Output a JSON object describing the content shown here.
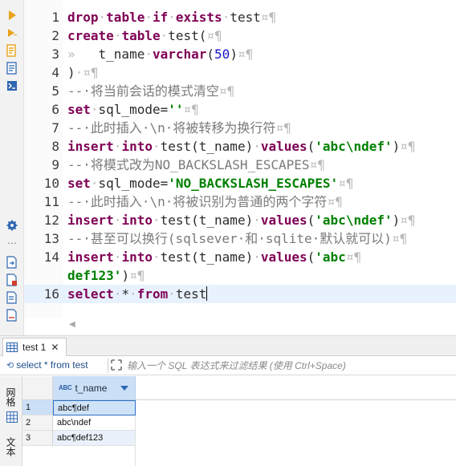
{
  "editor": {
    "lines": [
      {
        "num": "1",
        "tokens": [
          {
            "t": "drop",
            "c": "kw"
          },
          {
            "t": "·",
            "c": "ws"
          },
          {
            "t": "table",
            "c": "kw"
          },
          {
            "t": "·",
            "c": "ws"
          },
          {
            "t": "if",
            "c": "kw"
          },
          {
            "t": "·",
            "c": "ws"
          },
          {
            "t": "exists",
            "c": "kw"
          },
          {
            "t": "·",
            "c": "ws"
          },
          {
            "t": "test",
            "c": "id"
          },
          {
            "t": "¤¶",
            "c": "ws"
          }
        ]
      },
      {
        "num": "2",
        "tokens": [
          {
            "t": "create",
            "c": "kw"
          },
          {
            "t": "·",
            "c": "ws"
          },
          {
            "t": "table",
            "c": "kw"
          },
          {
            "t": "·",
            "c": "ws"
          },
          {
            "t": "test(",
            "c": "id"
          },
          {
            "t": "¤¶",
            "c": "ws"
          }
        ]
      },
      {
        "num": "3",
        "tokens": [
          {
            "t": "»   ",
            "c": "ws"
          },
          {
            "t": "t_name",
            "c": "id"
          },
          {
            "t": "·",
            "c": "ws"
          },
          {
            "t": "varchar",
            "c": "kw"
          },
          {
            "t": "(",
            "c": "id"
          },
          {
            "t": "50",
            "c": "num"
          },
          {
            "t": ")",
            "c": "id"
          },
          {
            "t": "¤¶",
            "c": "ws"
          }
        ]
      },
      {
        "num": "4",
        "tokens": [
          {
            "t": ")",
            "c": "id"
          },
          {
            "t": "·¤¶",
            "c": "ws"
          }
        ]
      },
      {
        "num": "5",
        "tokens": [
          {
            "t": "--·将当前会话的模式清空",
            "c": "cm"
          },
          {
            "t": "¤¶",
            "c": "ws"
          }
        ]
      },
      {
        "num": "6",
        "tokens": [
          {
            "t": "set",
            "c": "kw"
          },
          {
            "t": "·",
            "c": "ws"
          },
          {
            "t": "sql_mode=",
            "c": "id"
          },
          {
            "t": "''",
            "c": "str"
          },
          {
            "t": "¤¶",
            "c": "ws"
          }
        ]
      },
      {
        "num": "7",
        "tokens": [
          {
            "t": "--·此时插入·\\n·将被转移为换行符",
            "c": "cm"
          },
          {
            "t": "¤¶",
            "c": "ws"
          }
        ]
      },
      {
        "num": "8",
        "tokens": [
          {
            "t": "insert",
            "c": "kw"
          },
          {
            "t": "·",
            "c": "ws"
          },
          {
            "t": "into",
            "c": "kw"
          },
          {
            "t": "·",
            "c": "ws"
          },
          {
            "t": "test(t_name)",
            "c": "id"
          },
          {
            "t": "·",
            "c": "ws"
          },
          {
            "t": "values",
            "c": "kw"
          },
          {
            "t": "(",
            "c": "id"
          },
          {
            "t": "'abc\\ndef'",
            "c": "str"
          },
          {
            "t": ")",
            "c": "id"
          },
          {
            "t": "¤¶",
            "c": "ws"
          }
        ]
      },
      {
        "num": "9",
        "tokens": [
          {
            "t": "--·将模式改为NO_BACKSLASH_ESCAPES",
            "c": "cm"
          },
          {
            "t": "¤¶",
            "c": "ws"
          }
        ]
      },
      {
        "num": "10",
        "tokens": [
          {
            "t": "set",
            "c": "kw"
          },
          {
            "t": "·",
            "c": "ws"
          },
          {
            "t": "sql_mode=",
            "c": "id"
          },
          {
            "t": "'NO_BACKSLASH_ESCAPES'",
            "c": "str"
          },
          {
            "t": "¤¶",
            "c": "ws"
          }
        ]
      },
      {
        "num": "11",
        "tokens": [
          {
            "t": "--·此时插入·\\n·将被识别为普通的两个字符",
            "c": "cm"
          },
          {
            "t": "¤¶",
            "c": "ws"
          }
        ]
      },
      {
        "num": "12",
        "tokens": [
          {
            "t": "insert",
            "c": "kw"
          },
          {
            "t": "·",
            "c": "ws"
          },
          {
            "t": "into",
            "c": "kw"
          },
          {
            "t": "·",
            "c": "ws"
          },
          {
            "t": "test(t_name)",
            "c": "id"
          },
          {
            "t": "·",
            "c": "ws"
          },
          {
            "t": "values",
            "c": "kw"
          },
          {
            "t": "(",
            "c": "id"
          },
          {
            "t": "'abc\\ndef'",
            "c": "str"
          },
          {
            "t": ")",
            "c": "id"
          },
          {
            "t": "¤¶",
            "c": "ws"
          }
        ]
      },
      {
        "num": "13",
        "tokens": [
          {
            "t": "--·甚至可以换行(sqlsever·和·sqlite·默认就可以)",
            "c": "cm"
          },
          {
            "t": "¤¶",
            "c": "ws"
          }
        ]
      },
      {
        "num": "14",
        "tokens": [
          {
            "t": "insert",
            "c": "kw"
          },
          {
            "t": "·",
            "c": "ws"
          },
          {
            "t": "into",
            "c": "kw"
          },
          {
            "t": "·",
            "c": "ws"
          },
          {
            "t": "test(t_name)",
            "c": "id"
          },
          {
            "t": "·",
            "c": "ws"
          },
          {
            "t": "values",
            "c": "kw"
          },
          {
            "t": "(",
            "c": "id"
          },
          {
            "t": "'abc",
            "c": "str"
          },
          {
            "t": "¤¶",
            "c": "ws"
          }
        ]
      },
      {
        "num": "",
        "tokens": [
          {
            "t": "def123'",
            "c": "str"
          },
          {
            "t": ")",
            "c": "id"
          },
          {
            "t": "¤¶",
            "c": "ws"
          }
        ]
      },
      {
        "num": "16",
        "current": true,
        "tokens": [
          {
            "t": "select",
            "c": "kw"
          },
          {
            "t": "·",
            "c": "ws"
          },
          {
            "t": "*",
            "c": "id"
          },
          {
            "t": "·",
            "c": "ws"
          },
          {
            "t": "from",
            "c": "kw"
          },
          {
            "t": "·",
            "c": "ws"
          },
          {
            "t": "test",
            "c": "id"
          }
        ]
      }
    ]
  },
  "toolbar": {
    "icons": [
      "run-icon",
      "run-script-icon",
      "explain-plan-icon",
      "load-script-icon",
      "terminal-icon",
      "settings-icon",
      "more-icon",
      "export-icon",
      "error-log-icon",
      "history-icon",
      "output-icon"
    ]
  },
  "result": {
    "tab_label": "test 1",
    "tab_close": "✕",
    "query_text": "select * from test",
    "filter_placeholder": "输入一个 SQL 表达式来过滤结果 (使用 Ctrl+Space)",
    "side_grid_label": "网格",
    "side_text_label": "文本",
    "column": {
      "type_label": "ABC",
      "name": "t_name"
    },
    "rows": [
      {
        "num": "1",
        "value": "abc¶def"
      },
      {
        "num": "2",
        "value": "abc\\ndef"
      },
      {
        "num": "3",
        "value": "abc¶def123"
      }
    ]
  },
  "colors": {
    "keyword": "#7f0055",
    "string": "#008000",
    "number": "#1515c8",
    "comment": "#7a7a7a",
    "selection": "#cfe3f8",
    "current_line": "#e8f2fe"
  }
}
